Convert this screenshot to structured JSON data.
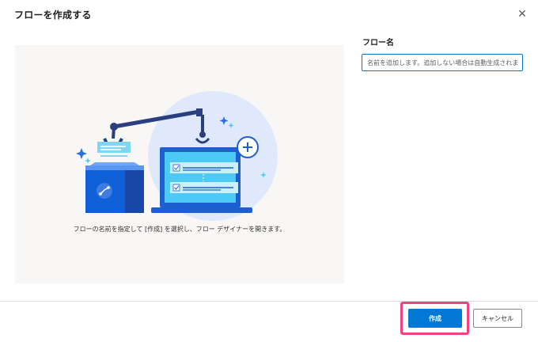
{
  "dialog": {
    "title": "フローを作成する",
    "close_glyph": "✕"
  },
  "illustration": {
    "caption": "フローの名前を指定して [作成] を選択し、フロー デザイナーを開きます。",
    "icons": [
      "robot-arm-icon",
      "laptop-icon",
      "box-icon",
      "add-circle-icon",
      "sparkle-icon"
    ]
  },
  "form": {
    "name_label": "フロー名",
    "name_placeholder": "名前を追加します。追加しない場合は自動生成されます",
    "name_value": ""
  },
  "footer": {
    "create_label": "作成",
    "cancel_label": "キャンセル"
  },
  "colors": {
    "primary": "#0078d4",
    "highlight": "#f0427e",
    "panel_bg": "#f8f7f6"
  }
}
